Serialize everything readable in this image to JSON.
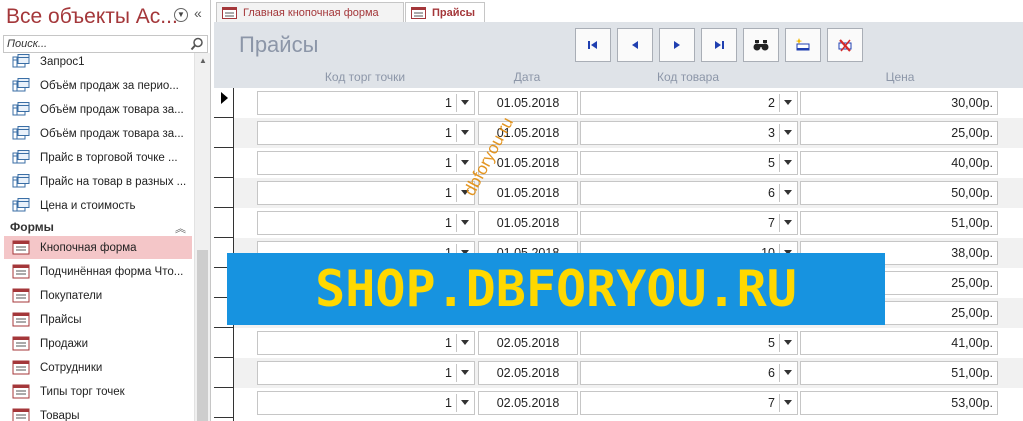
{
  "nav": {
    "title": "Все объекты Ac...",
    "search_placeholder": "Поиск...",
    "items_top": [
      "Запрос1",
      "Объём продаж за перио...",
      "Объём продаж товара за...",
      "Объём продаж товара за...",
      "Прайс в торговой точке ...",
      "Прайс на товар в разных ...",
      "Цена и стоимость"
    ],
    "group_label": "Формы",
    "form_items": [
      "Кнопочная форма",
      "Подчинённая форма Что...",
      "Покупатели",
      "Прайсы",
      "Продажи",
      "Сотрудники",
      "Типы торг точек",
      "Товары"
    ],
    "selected_item": "Кнопочная форма"
  },
  "tabs": [
    {
      "label": "Главная кнопочная форма",
      "active": false
    },
    {
      "label": "Прайсы",
      "active": true
    }
  ],
  "form": {
    "title": "Прайсы",
    "buttons": [
      {
        "name": "first-record-button",
        "icon": "first-record-icon"
      },
      {
        "name": "previous-record-button",
        "icon": "previous-record-icon"
      },
      {
        "name": "next-record-button",
        "icon": "next-record-icon"
      },
      {
        "name": "last-record-button",
        "icon": "last-record-icon"
      },
      {
        "name": "find-button",
        "icon": "binoculars-icon"
      },
      {
        "name": "new-record-button",
        "icon": "new-record-icon"
      },
      {
        "name": "delete-record-button",
        "icon": "delete-record-icon"
      }
    ],
    "columns": [
      "Код торг точки",
      "Дата",
      "Код товара",
      "Цена"
    ],
    "rows": [
      {
        "store": "1",
        "date": "01.05.2018",
        "product": "2",
        "price": "30,00р."
      },
      {
        "store": "1",
        "date": "01.05.2018",
        "product": "3",
        "price": "25,00р."
      },
      {
        "store": "1",
        "date": "01.05.2018",
        "product": "5",
        "price": "40,00р."
      },
      {
        "store": "1",
        "date": "01.05.2018",
        "product": "6",
        "price": "50,00р."
      },
      {
        "store": "1",
        "date": "01.05.2018",
        "product": "7",
        "price": "51,00р."
      },
      {
        "store": "1",
        "date": "01.05.2018",
        "product": "10",
        "price": "38,00р."
      },
      {
        "store": "",
        "date": "",
        "product": "",
        "price": "25,00р."
      },
      {
        "store": "",
        "date": "",
        "product": "",
        "price": "25,00р."
      },
      {
        "store": "1",
        "date": "02.05.2018",
        "product": "5",
        "price": "41,00р."
      },
      {
        "store": "1",
        "date": "02.05.2018",
        "product": "6",
        "price": "51,00р."
      },
      {
        "store": "1",
        "date": "02.05.2018",
        "product": "7",
        "price": "53,00р."
      }
    ]
  },
  "watermark": {
    "banner": "SHOP.DBFORYOU.RU",
    "diagonal": "dbforyou.ru"
  },
  "colors": {
    "title_red": "#a4373a",
    "selection_pink": "#f4c6c8",
    "header_bg": "#dfe3e8",
    "nav_arrow_blue": "#1f3fb0",
    "banner_blue": "#1793e0",
    "banner_yellow": "#ffd800"
  }
}
